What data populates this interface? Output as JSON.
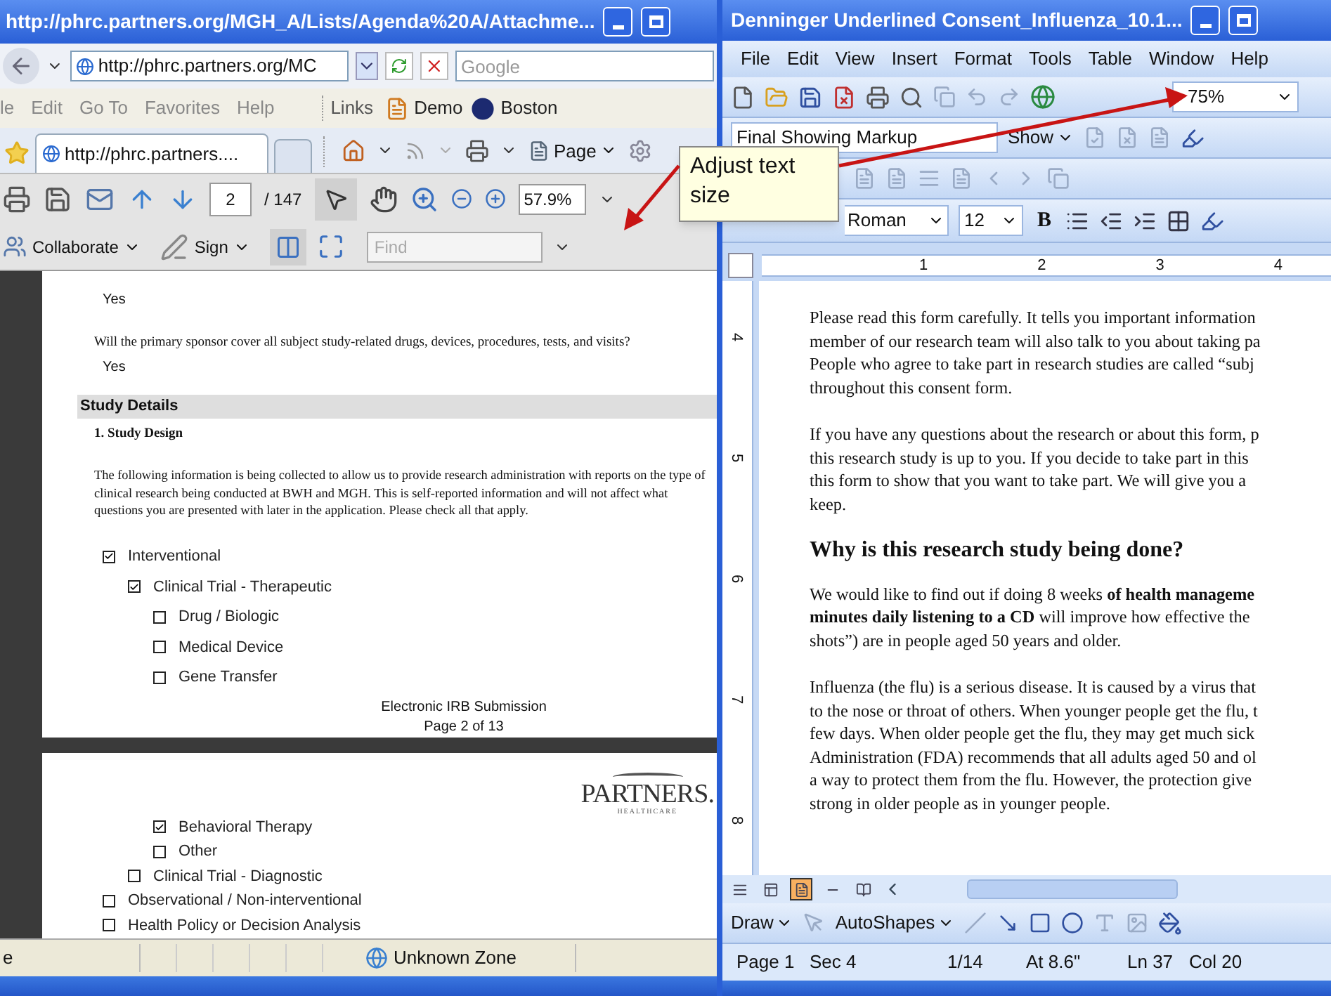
{
  "browser": {
    "title": "http://phrc.partners.org/MGH_A/Lists/Agenda%20A/Attachme...",
    "address": "http://phrc.partners.org/MC",
    "search": {
      "placeholder": "Google"
    },
    "menu": [
      "le",
      "Edit",
      "Go To",
      "Favorites",
      "Help"
    ],
    "links_label": "Links",
    "links": [
      "Demo",
      "Boston"
    ],
    "tab": {
      "label": "http://phrc.partners....",
      "selected": true
    },
    "page_menu": "Page",
    "status": {
      "left": "e",
      "zone": "Unknown Zone"
    }
  },
  "pdf": {
    "page": "2",
    "page_count": "/ 147",
    "zoom": "57.9%",
    "collaborate": "Collaborate",
    "sign": "Sign",
    "find": {
      "placeholder": "Find"
    },
    "page1": {
      "responses": [
        {
          "answer": "Yes"
        },
        {
          "question": "Will the primary sponsor cover all subject study-related drugs, devices, procedures, tests, and visits?",
          "answer": "Yes"
        }
      ],
      "section": "Study Details",
      "subsection": "1.  Study Design",
      "intro": "The following information is being collected to allow us to provide research administration with reports on the type of clinical research being conducted at BWH and MGH.  This is self-reported information and will not affect what questions you are presented with later in the application.  Please check all that apply.",
      "checklist": [
        {
          "label": "Interventional",
          "checked": true,
          "children": [
            {
              "label": "Clinical Trial - Therapeutic",
              "checked": true,
              "children": [
                {
                  "label": "Drug / Biologic",
                  "checked": false
                },
                {
                  "label": "Medical Device",
                  "checked": false
                },
                {
                  "label": "Gene Transfer",
                  "checked": false
                }
              ]
            }
          ]
        }
      ],
      "footer": [
        "Electronic IRB Submission",
        "Page 2 of 13"
      ]
    },
    "page2": {
      "logo": {
        "name": "PARTNERS.",
        "tagline": "HEALTHCARE"
      },
      "checklist": [
        {
          "children": [
            {
              "children": [
                {
                  "label": "Behavioral Therapy",
                  "checked": true
                },
                {
                  "label": "Other",
                  "checked": false
                }
              ]
            },
            {
              "label": "Clinical Trial - Diagnostic",
              "checked": false
            }
          ]
        },
        {
          "label": "Observational / Non-interventional",
          "checked": false
        },
        {
          "label": "Health Policy or Decision Analysis",
          "checked": false
        }
      ]
    }
  },
  "callout": {
    "text": "Adjust text size"
  },
  "word": {
    "title": "Denninger Underlined Consent_Influenza_10.1...",
    "menu": [
      "File",
      "Edit",
      "View",
      "Insert",
      "Format",
      "Tools",
      "Table",
      "Window",
      "Help"
    ],
    "zoom": "75%",
    "markup": "Final Showing Markup",
    "show": "Show",
    "font": "Roman",
    "size": "12",
    "bold": "B",
    "ruler": {
      "h": [
        "1",
        "2",
        "3",
        "4"
      ],
      "v": [
        "4",
        "5",
        "6",
        "7",
        "8"
      ]
    },
    "doc": [
      {
        "kind": "para",
        "lines": [
          "Please read this form carefully.  It tells you important information",
          "member of our research team will also talk to you about taking pa",
          "People who agree to take part in research studies are called “subj",
          "throughout this consent form."
        ]
      },
      {
        "kind": "para",
        "lines": [
          "If you have any questions about the research or about this form, p",
          "this research study is up to you.  If you decide to take part in this",
          "this form to show that you want to take part.  We will give you a",
          "keep."
        ]
      },
      {
        "kind": "heading",
        "lines": [
          "Why is this research study being done?"
        ]
      },
      {
        "kind": "para",
        "lines": [
          "We would like to find out if doing 8 weeks **of health manageme**",
          "**minutes daily listening to a CD** will improve how effective the",
          "shots”) are in people aged 50 years and older."
        ]
      },
      {
        "kind": "para",
        "lines": [
          "Influenza (the flu) is a serious disease. It is caused by a virus that",
          "to the nose or throat of others. When younger people get the flu, t",
          "few days. When older people get the flu, they may get much sick",
          "Administration (FDA) recommends that all adults aged 50 and ol",
          "a way to protect them from the flu. However, the protection give",
          "strong in older people as in younger people."
        ]
      }
    ],
    "views": [
      {
        "selected": false
      },
      {
        "selected": false
      },
      {
        "selected": true
      },
      {
        "selected": false
      },
      {
        "selected": false
      }
    ],
    "draw": [
      "Draw",
      "AutoShapes"
    ],
    "status": [
      "Page 1",
      "Sec 4",
      "1/14",
      "At 8.6\"",
      "Ln 37",
      "Col 20"
    ]
  }
}
